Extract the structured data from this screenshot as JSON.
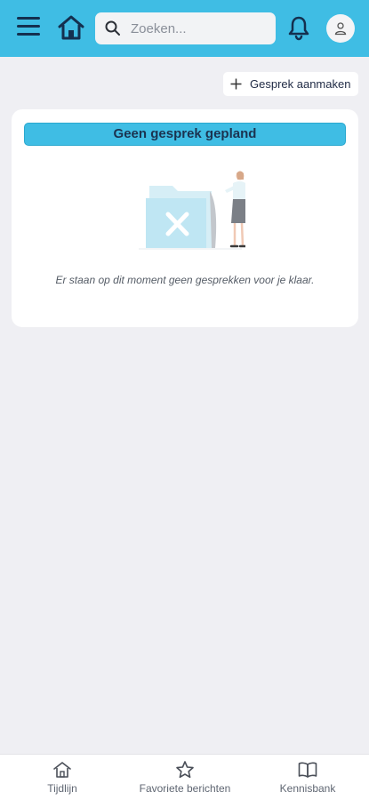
{
  "header": {
    "search": {
      "placeholder": "Zoeken..."
    },
    "icons": [
      "menu-icon",
      "home-icon",
      "search-icon",
      "bell-icon",
      "user-icon"
    ]
  },
  "actions": {
    "create_label": "Gesprek aanmaken"
  },
  "card": {
    "banner": "Geen gesprek gepland",
    "empty_message": "Er staan op dit moment geen gesprekken voor je klaar."
  },
  "bottom_nav": {
    "items": [
      {
        "label": "Tijdlijn",
        "icon": "home-icon"
      },
      {
        "label": "Favoriete berichten",
        "icon": "star-icon"
      },
      {
        "label": "Kennisbank",
        "icon": "book-icon"
      }
    ]
  },
  "colors": {
    "accent": "#3fbde4",
    "background": "#efeff3",
    "dark": "#14304f"
  }
}
